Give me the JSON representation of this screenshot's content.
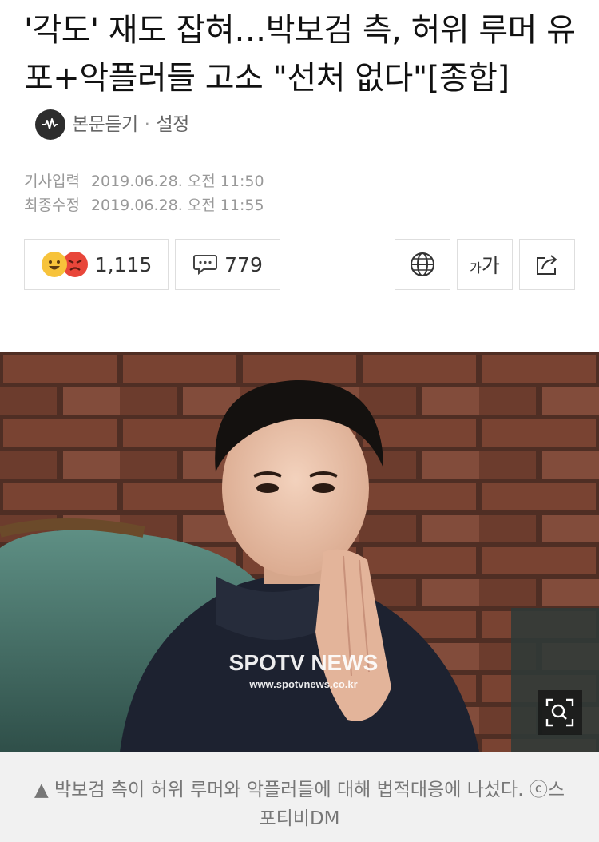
{
  "article": {
    "title": "'각도' 재도 잡혀…박보검 측, 허위 루머 유포+악플러들 고소 \"선처 없다\"[종합]",
    "listen_label": "본문듣기",
    "separator": "·",
    "settings_label": "설정",
    "published_label": "기사입력",
    "published_value": "2019.06.28. 오전 11:50",
    "modified_label": "최종수정",
    "modified_value": "2019.06.28. 오전 11:55"
  },
  "actions": {
    "reaction_count": "1,115",
    "comment_count": "779",
    "font_size_label_small": "가",
    "font_size_label_large": "가"
  },
  "photo": {
    "watermark_brand": "SPOTV NEWS",
    "watermark_url": "www.spotvnews.co.kr",
    "caption": "▲ 박보검 측이 허위 루머와 악플러들에 대해 법적대응에 나섰다. ⓒ스포티비DM"
  },
  "icons": {
    "listen": "listen-icon",
    "reaction_happy": "smile-emoji-icon",
    "reaction_angry": "angry-emoji-icon",
    "comment": "comment-bubble-icon",
    "translate": "globe-icon",
    "share": "share-icon",
    "zoom": "zoom-icon"
  },
  "colors": {
    "text": "#111111",
    "meta": "#999999",
    "border": "#dedede",
    "caption_bg": "#f1f1f1"
  }
}
